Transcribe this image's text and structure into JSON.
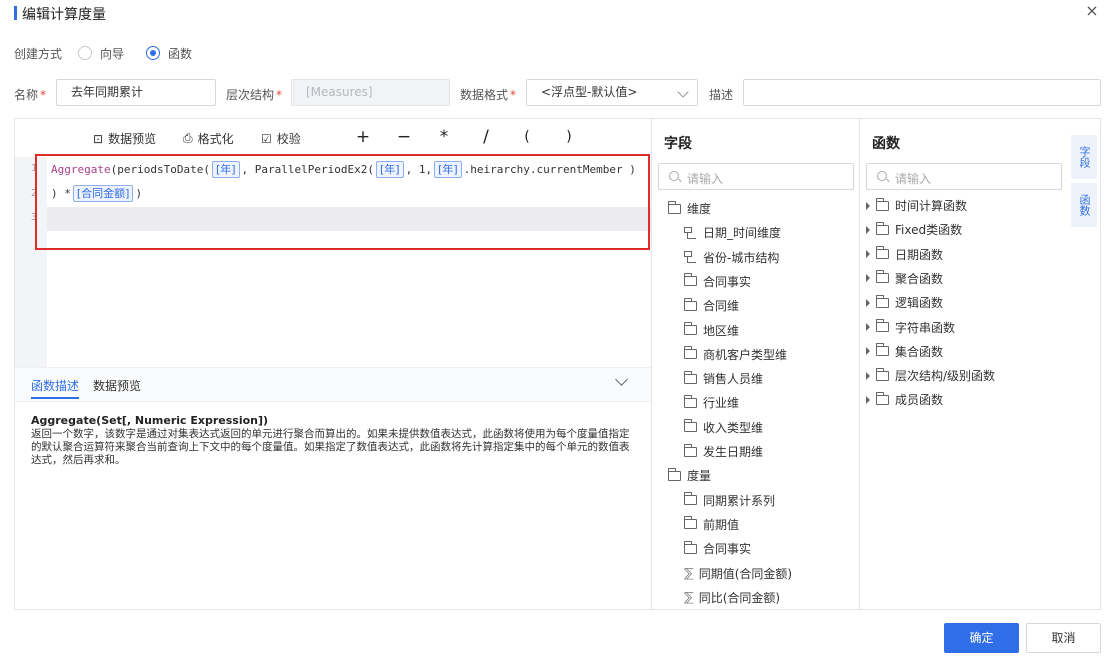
{
  "dialog": {
    "title": "编辑计算度量",
    "close": "×"
  },
  "mode": {
    "label": "创建方式",
    "options": [
      "向导",
      "函数"
    ],
    "selected": "函数"
  },
  "form": {
    "name_label": "名称",
    "name_value": "去年同期累计",
    "hierarchy_label": "层次结构",
    "hierarchy_value": "[Measures]",
    "format_label": "数据格式",
    "format_value": "<浮点型-默认值>",
    "desc_label": "描述",
    "desc_value": "",
    "required_mark": "*"
  },
  "toolbar": {
    "preview": "数据预览",
    "format": "格式化",
    "validate": "校验",
    "ops": [
      "+",
      "−",
      "*",
      "/",
      "(",
      ")"
    ]
  },
  "editor": {
    "line_numbers": [
      "1",
      "2",
      "3"
    ],
    "line1": {
      "func": "Aggregate",
      "p1": "(periodsToDate(",
      "t1": "[年]",
      "p2": ", ParallelPeriodEx2(",
      "t2": "[年]",
      "p3": ", 1,",
      "t3": "[年]",
      "p4": ".heirarchy.currentMember )"
    },
    "line2": {
      "p1": ") *",
      "t1": "[合同金额]",
      "p2": ")"
    }
  },
  "description": {
    "tabs": [
      "函数描述",
      "数据预览"
    ],
    "active_tab": "函数描述",
    "signature": "Aggregate(Set[, Numeric Expression])",
    "text": "返回一个数字，该数字是通过对集表达式返回的单元进行聚合而算出的。如果未提供数值表达式，此函数将使用为每个度量值指定的默认聚合运算符来聚合当前查询上下文中的每个度量值。如果指定了数值表达式，此函数将先计算指定集中的每个单元的数值表达式，然后再求和。"
  },
  "fields": {
    "title": "字段",
    "search_placeholder": "请输入",
    "dimension_group": "维度",
    "dimensions": [
      {
        "label": "日期_时间维度",
        "icon": "hierarchy"
      },
      {
        "label": "省份-城市结构",
        "icon": "hierarchy"
      },
      {
        "label": "合同事实",
        "icon": "folder"
      },
      {
        "label": "合同维",
        "icon": "folder"
      },
      {
        "label": "地区维",
        "icon": "folder"
      },
      {
        "label": "商机客户类型维",
        "icon": "folder"
      },
      {
        "label": "销售人员维",
        "icon": "folder"
      },
      {
        "label": "行业维",
        "icon": "folder"
      },
      {
        "label": "收入类型维",
        "icon": "folder"
      },
      {
        "label": "发生日期维",
        "icon": "folder"
      }
    ],
    "measure_group": "度量",
    "measures": [
      {
        "label": "同期累计系列",
        "icon": "folder"
      },
      {
        "label": "前期值",
        "icon": "folder"
      },
      {
        "label": "合同事实",
        "icon": "folder"
      },
      {
        "label": "同期值(合同金额)",
        "icon": "measure"
      },
      {
        "label": "同比(合同金额)",
        "icon": "measure"
      }
    ]
  },
  "functions": {
    "title": "函数",
    "search_placeholder": "请输入",
    "items": [
      "时间计算函数",
      "Fixed类函数",
      "日期函数",
      "聚合函数",
      "逻辑函数",
      "字符串函数",
      "集合函数",
      "层次结构/级别函数",
      "成员函数"
    ]
  },
  "side_tabs": [
    "字段",
    "函数"
  ],
  "buttons": {
    "ok": "确定",
    "cancel": "取消"
  },
  "colors": {
    "accent": "#2f6ee6",
    "highlight": "#e02b2b",
    "required": "#e5483d"
  }
}
